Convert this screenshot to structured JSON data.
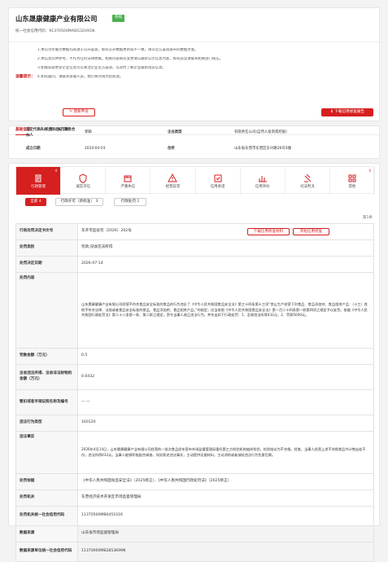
{
  "company": {
    "name": "山东晟康健康产业有限公司",
    "status": "存续",
    "credit_code_label": "统一社会信用代码：",
    "credit_code": "91370500MADG32U91N"
  },
  "notice": {
    "label": "温馨提示：",
    "lines": [
      "1.本公示所展示数据均来源于公开渠道，如有公开数据更新或不一致，请以官方渠道发布的数据为准。",
      "2.本信息仅供参考，不作为任何法律依据，相关内容如有变更请以最新公示信息为准，如有异议请联系相关部门核实。",
      "3.如需获取更多企业信息可以关注企业官方渠道，以及时了解企业最新动态信息。",
      "4.如有疑问，请联系客服人员，我们将尽快为您处理。"
    ],
    "left_button": "我要申诉",
    "right_button": "下载信用修复报告"
  },
  "basic_tabs": [
    "基础信息",
    "商米注册登记信息"
  ],
  "basic_table": {
    "rows": [
      {
        "l1": "法定代表人/负责人/执行事务合伙人",
        "v1": "郭颖",
        "l2": "企业类型",
        "v2": "有限责任公司(自然人投资或控股)"
      },
      {
        "l1": "成立日期",
        "v1": "2024-04-03",
        "l2": "住所",
        "v2": "山东省东营市东营区东兴路26号5幢"
      }
    ]
  },
  "nav_tabs": [
    {
      "label": "行政管理",
      "icon": "admin-icon",
      "badge": "4",
      "active": true
    },
    {
      "label": "诚实守信",
      "icon": "honesty-icon",
      "badge": "",
      "active": false
    },
    {
      "label": "严重失信",
      "icon": "serious-dishonest-icon",
      "badge": "",
      "active": false
    },
    {
      "label": "经营异常",
      "icon": "abnormal-icon",
      "badge": "",
      "active": false
    },
    {
      "label": "信用承诺",
      "icon": "commitment-icon",
      "badge": "",
      "active": false
    },
    {
      "label": "信用评价",
      "icon": "evaluation-icon",
      "badge": "",
      "active": false
    },
    {
      "label": "司法判决",
      "icon": "judgment-icon",
      "badge": "",
      "active": false
    },
    {
      "label": "其他",
      "icon": "other-icon",
      "badge": "0",
      "active": false
    }
  ],
  "sub_tabs": [
    {
      "label": "全部",
      "count": "4",
      "active": true
    },
    {
      "label": "行政许可（新标准）",
      "count": "3",
      "active": false
    },
    {
      "label": "行政处罚",
      "count": "1",
      "active": false
    }
  ],
  "page_indicator": "第1条",
  "detail": {
    "download_btn": "下载信用修复材料",
    "repair_btn": "开始信用修复",
    "rows": [
      {
        "label": "行政处罚决定书文号",
        "value": "东开市监处罚〔2026〕202号"
      },
      {
        "label": "处罚类别",
        "value": "罚款;没收违法所得"
      },
      {
        "label": "处罚决定日期",
        "value": "2026-07-14"
      },
      {
        "label": "处罚内容",
        "value": "山东晟康健康产业有限公司经营不符合食品安全标准的食品的行为违反了《中华人民共和国食品安全法》第三十四条第十三项“禁止生产经营下列食品、食品添加剂、食品相关产品：（十三）其他不符合法律、法规或者食品安全标准的食品、食品添加剂、食品相关产品。”的规定，应当依照《中华人民共和国食品安全法》第一百二十四条第一款第四项之规定予以处罚。依据《中华人民共和国行政处罚法》第二十八条第一款、第二款之规定，责令当事人改正违法行为，并作出如下行政处罚：1、没收违法所得432元；2、罚款5000元。"
      },
      {
        "label": "罚款金额（万元）",
        "value": "0.5"
      },
      {
        "label": "没收违法所得、没收非法财物的金额（万元）",
        "value": "0.0432"
      },
      {
        "label": "暂扣或者吊销证照名称及编号",
        "value": "— —"
      },
      {
        "label": "违法行为类型",
        "value": "160120"
      },
      {
        "label": "违法事实",
        "value": "2026年4月14日，山东晟康健康产业有限公司经营的一批次食品经东营市市场监督管理局委托第三方检验机构抽样检验，检验结论为不合格。经查，当事人经营上述不合格食品共计售出若干份，违法所得432元。当事人能够积极配合调查，如实陈述违法事实，主动提供证据材料，主动消除或者减轻违法行为危害后果。"
      },
      {
        "label": "处罚依据",
        "value": "《中华人民共和国食品安全法》（2025修正）、《中华人民共和国行政处罚法》（2025修正）"
      },
      {
        "label": "处罚机关",
        "value": "东营经济技术开发区市场监督管理局"
      },
      {
        "label": "处罚机关统一社会信用代码",
        "value": "11370500MB0451016"
      },
      {
        "label": "数据来源",
        "value": "山东省市场监督管理局"
      },
      {
        "label": "数据来源单位统一社会信用代码",
        "value": "11370000MB2853699N"
      }
    ]
  },
  "colors": {
    "accent": "#d61f1f",
    "status_green": "#4caf50"
  }
}
